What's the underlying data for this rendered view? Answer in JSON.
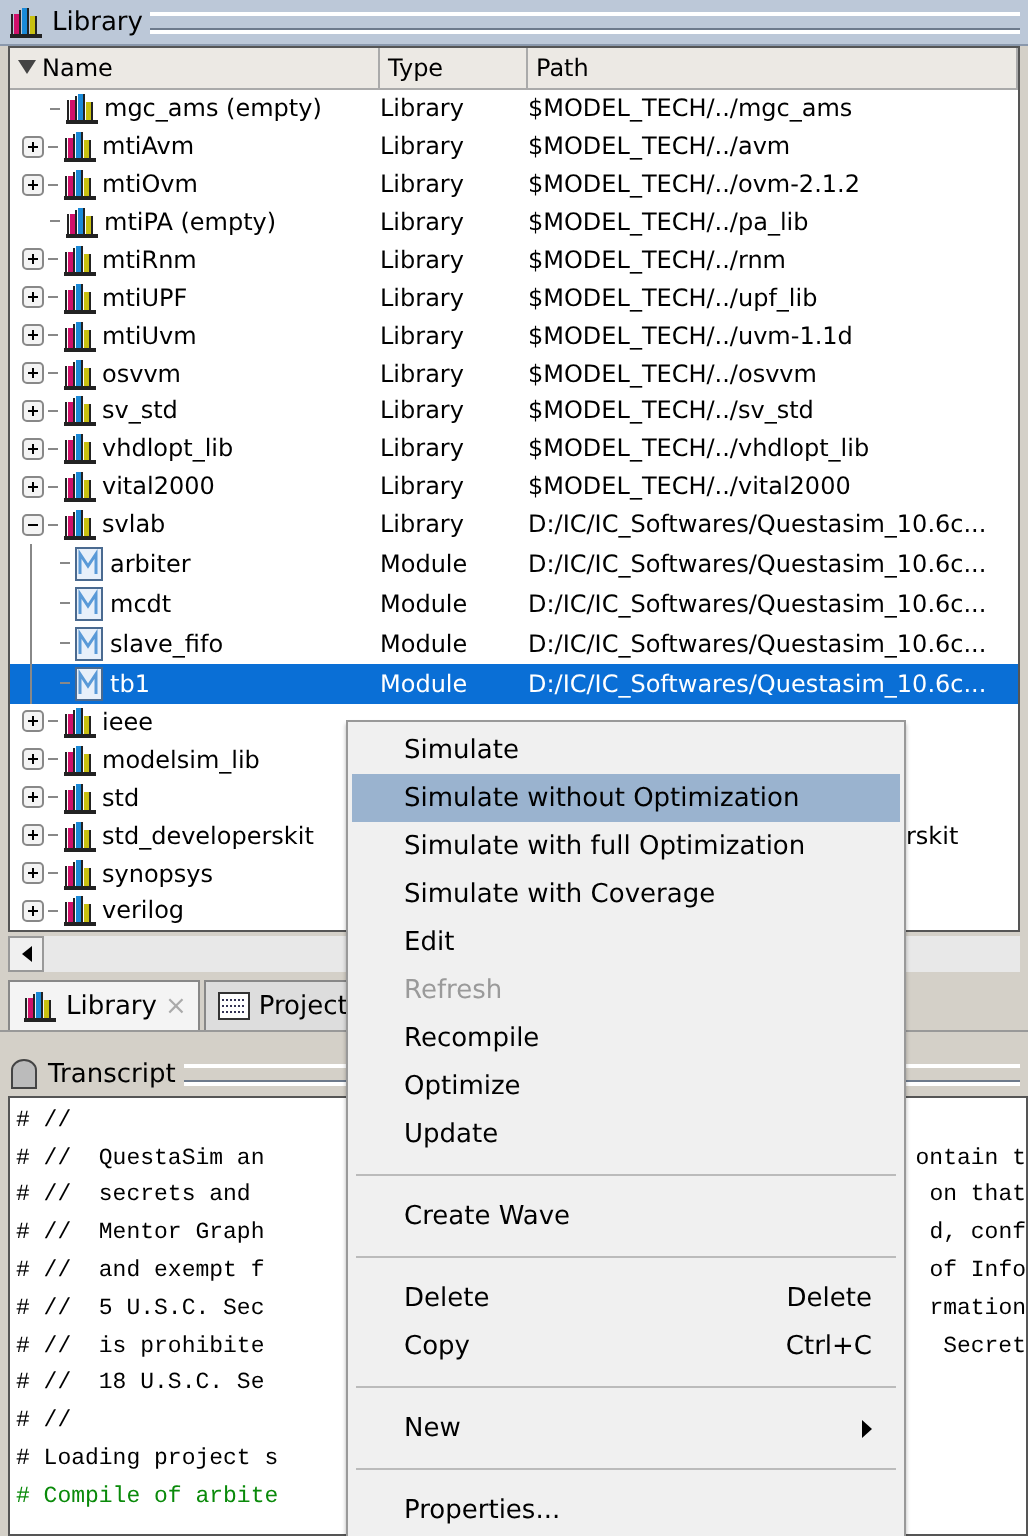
{
  "library": {
    "title": "Library",
    "columns": [
      "Name",
      "Type",
      "Path"
    ],
    "rows": [
      {
        "name": "mgc_ams  (empty)",
        "type": "Library",
        "path": "$MODEL_TECH/../mgc_ams",
        "kind": "empty-library",
        "selected": false
      },
      {
        "name": "mtiAvm",
        "type": "Library",
        "path": "$MODEL_TECH/../avm",
        "kind": "library",
        "expanded": false,
        "selected": false
      },
      {
        "name": "mtiOvm",
        "type": "Library",
        "path": "$MODEL_TECH/../ovm-2.1.2",
        "kind": "library",
        "expanded": false,
        "selected": false
      },
      {
        "name": "mtiPA  (empty)",
        "type": "Library",
        "path": "$MODEL_TECH/../pa_lib",
        "kind": "empty-library",
        "selected": false
      },
      {
        "name": "mtiRnm",
        "type": "Library",
        "path": "$MODEL_TECH/../rnm",
        "kind": "library",
        "expanded": false,
        "selected": false
      },
      {
        "name": "mtiUPF",
        "type": "Library",
        "path": "$MODEL_TECH/../upf_lib",
        "kind": "library",
        "expanded": false,
        "selected": false
      },
      {
        "name": "mtiUvm",
        "type": "Library",
        "path": "$MODEL_TECH/../uvm-1.1d",
        "kind": "library",
        "expanded": false,
        "selected": false
      },
      {
        "name": "osvvm",
        "type": "Library",
        "path": "$MODEL_TECH/../osvvm",
        "kind": "library",
        "expanded": false,
        "selected": false
      },
      {
        "name": "sv_std",
        "type": "Library",
        "path": "$MODEL_TECH/../sv_std",
        "kind": "library",
        "expanded": false,
        "selected": false
      },
      {
        "name": "vhdlopt_lib",
        "type": "Library",
        "path": "$MODEL_TECH/../vhdlopt_lib",
        "kind": "library",
        "expanded": false,
        "selected": false
      },
      {
        "name": "vital2000",
        "type": "Library",
        "path": "$MODEL_TECH/../vital2000",
        "kind": "library",
        "expanded": false,
        "selected": false
      },
      {
        "name": "svlab",
        "type": "Library",
        "path": "D:/IC/IC_Softwares/Questasim_10.6c...",
        "kind": "library",
        "expanded": true,
        "selected": false,
        "children": [
          {
            "name": "arbiter",
            "type": "Module",
            "path": "D:/IC/IC_Softwares/Questasim_10.6c...",
            "kind": "module",
            "selected": false
          },
          {
            "name": "mcdt",
            "type": "Module",
            "path": "D:/IC/IC_Softwares/Questasim_10.6c...",
            "kind": "module",
            "selected": false
          },
          {
            "name": "slave_fifo",
            "type": "Module",
            "path": "D:/IC/IC_Softwares/Questasim_10.6c...",
            "kind": "module",
            "selected": false
          },
          {
            "name": "tb1",
            "type": "Module",
            "path": "D:/IC/IC_Softwares/Questasim_10.6c...",
            "kind": "module",
            "selected": true
          }
        ]
      },
      {
        "name": "ieee",
        "kind": "library",
        "expanded": false,
        "selected": false
      },
      {
        "name": "modelsim_lib",
        "kind": "library",
        "expanded": false,
        "selected": false
      },
      {
        "name": "std",
        "kind": "library",
        "expanded": false,
        "selected": false
      },
      {
        "name": "std_developerskit",
        "path_tail": "rskit",
        "kind": "library",
        "expanded": false,
        "selected": false
      },
      {
        "name": "synopsys",
        "kind": "library",
        "expanded": false,
        "selected": false
      },
      {
        "name": "verilog",
        "kind": "library",
        "expanded": false,
        "selected": false
      }
    ]
  },
  "tabs": [
    {
      "label": "Library",
      "kind": "library",
      "selected": true,
      "close": "×"
    },
    {
      "label": "Project",
      "kind": "project",
      "selected": false
    }
  ],
  "transcript": {
    "title": "Transcript",
    "lines": [
      {
        "left": "# //",
        "kind": "plain"
      },
      {
        "left": "# //  QuestaSim an",
        "right": "ontain t",
        "kind": "plain"
      },
      {
        "left": "# //  secrets and",
        "right": "on that",
        "kind": "plain"
      },
      {
        "left": "# //  Mentor Graph",
        "right": "d, conf",
        "kind": "plain"
      },
      {
        "left": "# //  and exempt f",
        "right": "of Info",
        "kind": "plain"
      },
      {
        "left": "# //  5 U.S.C. Sec",
        "right": "rmation",
        "kind": "plain"
      },
      {
        "left": "# //  is prohibite",
        "right": "Secret",
        "kind": "plain"
      },
      {
        "left": "# //  18 U.S.C. Se",
        "kind": "plain"
      },
      {
        "left": "# //",
        "kind": "plain"
      },
      {
        "left": "# Loading project s",
        "kind": "plain"
      },
      {
        "left": "# Compile of arbite",
        "kind": "success"
      }
    ]
  },
  "context_menu": {
    "items": [
      {
        "kind": "item",
        "label": "Simulate",
        "highlighted": false,
        "disabled": false
      },
      {
        "kind": "item",
        "label": "Simulate without Optimization",
        "highlighted": true,
        "disabled": false
      },
      {
        "kind": "item",
        "label": "Simulate with full Optimization",
        "highlighted": false,
        "disabled": false
      },
      {
        "kind": "item",
        "label": "Simulate with Coverage",
        "highlighted": false,
        "disabled": false
      },
      {
        "kind": "item",
        "label": "Edit",
        "highlighted": false,
        "disabled": false
      },
      {
        "kind": "item",
        "label": "Refresh",
        "highlighted": false,
        "disabled": true
      },
      {
        "kind": "item",
        "label": "Recompile",
        "highlighted": false,
        "disabled": false
      },
      {
        "kind": "item",
        "label": "Optimize",
        "highlighted": false,
        "disabled": false
      },
      {
        "kind": "item",
        "label": "Update",
        "highlighted": false,
        "disabled": false
      },
      {
        "kind": "separator"
      },
      {
        "kind": "item",
        "label": "Create Wave",
        "highlighted": false,
        "disabled": false
      },
      {
        "kind": "separator"
      },
      {
        "kind": "item",
        "label": "Delete",
        "shortcut": "Delete",
        "highlighted": false,
        "disabled": false
      },
      {
        "kind": "item",
        "label": "Copy",
        "shortcut": "Ctrl+C",
        "highlighted": false,
        "disabled": false
      },
      {
        "kind": "separator"
      },
      {
        "kind": "item",
        "label": "New",
        "submenu": true,
        "highlighted": false,
        "disabled": false
      },
      {
        "kind": "separator"
      },
      {
        "kind": "item",
        "label": "Properties...",
        "highlighted": false,
        "disabled": false
      }
    ]
  }
}
